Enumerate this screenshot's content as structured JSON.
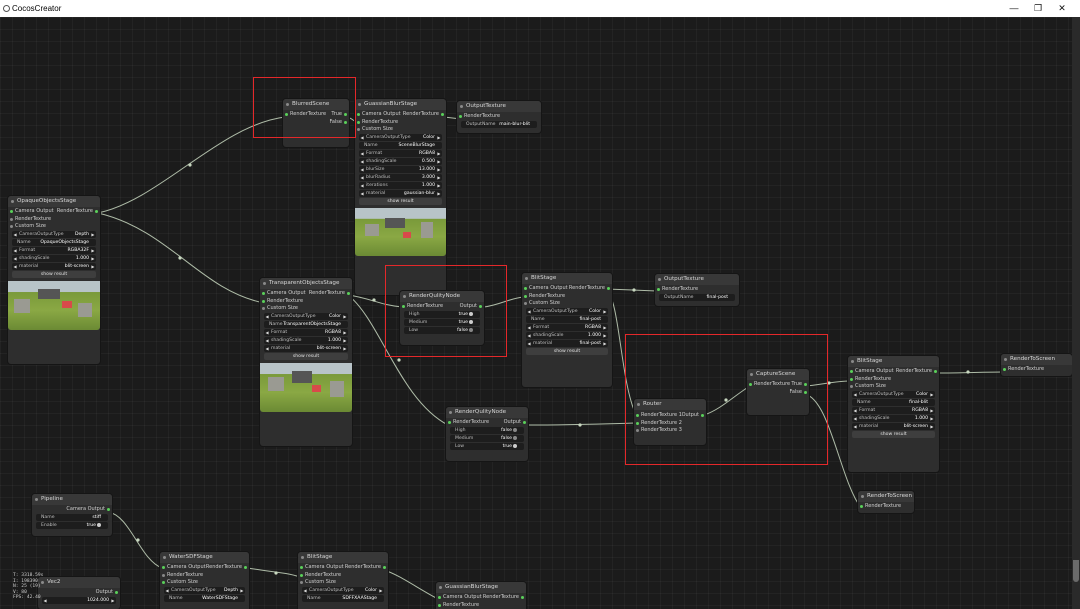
{
  "app": {
    "title": "CocosCreator",
    "minimize": "—",
    "restore": "❐",
    "close": "✕"
  },
  "labels": {
    "camera_output": "Camera Output",
    "render_texture": "RenderTexture",
    "custom_size": "Custom Size",
    "output": "Output",
    "true": "True",
    "false": "False",
    "render_texture_1": "RenderTexture 1",
    "render_texture_2": "RenderTexture 2",
    "render_texture_3": "RenderTexture 3",
    "high": "High",
    "medium": "Medium",
    "low": "Low",
    "show_result": "show result",
    "camera_output_type": "CameraOutputType",
    "name": "Name",
    "format": "Format",
    "shading_scale": "shadingScale",
    "material": "material",
    "blur_size": "blurSize",
    "blur_radius": "blurRadius",
    "iterations": "iterations",
    "output_name": "OutputName",
    "enable": "Enable"
  },
  "nodes": {
    "blurred_scene": {
      "title": "BlurredScene",
      "true_val": "True",
      "false_val": "False"
    },
    "gaussian_blur_stage": {
      "title": "GuassianBlurStage",
      "camera_output_type": "Color",
      "name": "SceneBlurStage",
      "format": "RGBA8",
      "shading_scale": "0.500",
      "blur_size": "13.000",
      "blur_radius": "3.000",
      "iterations": "1.000",
      "material": "gaussian-blur"
    },
    "output_texture_1": {
      "title": "OutputTexture",
      "output_name": "main-blur-blit"
    },
    "opaque_objects_stage": {
      "title": "OpaqueObjectsStage",
      "camera_output_type": "Depth",
      "name": "OpaqueObjectsStage",
      "format": "RGBA32F",
      "shading_scale": "1.000",
      "material": "blit-screen"
    },
    "transparent_objects_stage": {
      "title": "TransparentObjectsStage",
      "camera_output_type": "Color",
      "name": "TransparentObjectsStage",
      "format": "RGBA8",
      "shading_scale": "1.000",
      "material": "blit-screen"
    },
    "render_quality_node_1": {
      "title": "RenderQulityNode",
      "high": "true",
      "medium": "true",
      "low": "false"
    },
    "blit_stage_1": {
      "title": "BlitStage",
      "camera_output_type": "Color",
      "name": "final-post",
      "format": "RGBA8",
      "shading_scale": "1.000",
      "material": "final-post"
    },
    "output_texture_2": {
      "title": "OutputTexture",
      "output_name": "final-post"
    },
    "render_quality_node_2": {
      "title": "RenderQulityNode",
      "high": "false",
      "medium": "false",
      "low": "true"
    },
    "router": {
      "title": "Router"
    },
    "capture_scene": {
      "title": "CaptureScene",
      "true_val": "True",
      "false_val": "False"
    },
    "blit_stage_2": {
      "title": "BlitStage",
      "camera_output_type": "Color",
      "name": "final-blit",
      "format": "RGBA8",
      "shading_scale": "1.000",
      "material": "blit-screen"
    },
    "render_to_screen_1": {
      "title": "RenderToScreen"
    },
    "render_to_screen_2": {
      "title": "RenderToScreen"
    },
    "pipeline": {
      "title": "Pipeline",
      "name": "stiff",
      "enable": "true"
    },
    "water_sdf_stage": {
      "title": "WaterSDFStage",
      "camera_output_type": "Depth",
      "name": "WaterSDFStage"
    },
    "blit_stage_3": {
      "title": "BlitStage",
      "camera_output_type": "Color",
      "name": "SDFFXAAStage"
    },
    "gaussian_blur_stage_2": {
      "title": "GuassianBlurStage"
    },
    "vec2": {
      "title": "Vec2",
      "value": "1024.000"
    }
  },
  "stats": {
    "line1": "T: 3318.59s",
    "line2": "I: 198390",
    "line3": "N: 25 (19)",
    "line4": "V: 80",
    "line5": "FPS: 42.40"
  }
}
